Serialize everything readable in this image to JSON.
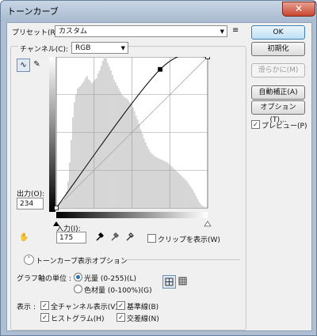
{
  "window": {
    "title": "トーンカーブ",
    "close_label": "✕"
  },
  "preset": {
    "label": "プリセット(R):",
    "value": "カスタム",
    "menu_icon": "≡"
  },
  "channel": {
    "label": "チャンネル(C):",
    "value": "RGB"
  },
  "buttons": {
    "ok": "OK",
    "reset": "初期化",
    "smooth": "滑らかに(M)",
    "auto": "自動補正(A)",
    "options": "オプション(T)..."
  },
  "preview": {
    "label": "プレビュー(P)",
    "checked": true
  },
  "output": {
    "label": "出力(O):",
    "value": "234"
  },
  "input": {
    "label": "入力(I):",
    "value": "175"
  },
  "clip": {
    "label": "クリップを表示(W)",
    "checked": false
  },
  "curve_options": {
    "toggle_label": "トーンカーブ表示オプション"
  },
  "graph_units": {
    "label": "グラフ軸の単位 :",
    "light": "光量 (0-255)(L)",
    "pigment": "色材量 (0-100%)(G)",
    "selected": "light"
  },
  "display": {
    "label": "表示 :",
    "all_channels": "全チャンネル表示(V)",
    "histogram": "ヒストグラム(H)",
    "baseline": "基準線(B)",
    "intersection": "交差線(N)"
  },
  "chart_data": {
    "type": "area",
    "x_range": [
      0,
      255
    ],
    "y_range": [
      0,
      255
    ],
    "grid": "4x4",
    "curve_points": [
      [
        0,
        0
      ],
      [
        175,
        234
      ],
      [
        255,
        255
      ]
    ],
    "histogram_levels": [
      2,
      3,
      4,
      6,
      9,
      14,
      22,
      35,
      60,
      90,
      120,
      140,
      150,
      158,
      160,
      162,
      165,
      168,
      172,
      175,
      170,
      168,
      165,
      167,
      170,
      172,
      178,
      182,
      188,
      195,
      200,
      198,
      192,
      187,
      182,
      176,
      170,
      166,
      162,
      158,
      154,
      150,
      148,
      146,
      145,
      143,
      140,
      137,
      133,
      128,
      122,
      117,
      111,
      104,
      98,
      92,
      87,
      82,
      78,
      74,
      72,
      70,
      68,
      67,
      66,
      65,
      64,
      63,
      62,
      61,
      60,
      58,
      56,
      54,
      52,
      50,
      48,
      46,
      44,
      42,
      40,
      38,
      36,
      33,
      30,
      27,
      24,
      20,
      16,
      12,
      8,
      5,
      3,
      2,
      1,
      0
    ]
  },
  "colors": {
    "accent": "#2a6cb0",
    "histogram": "#d6d6d6",
    "window_frame": "#aebfd3"
  }
}
